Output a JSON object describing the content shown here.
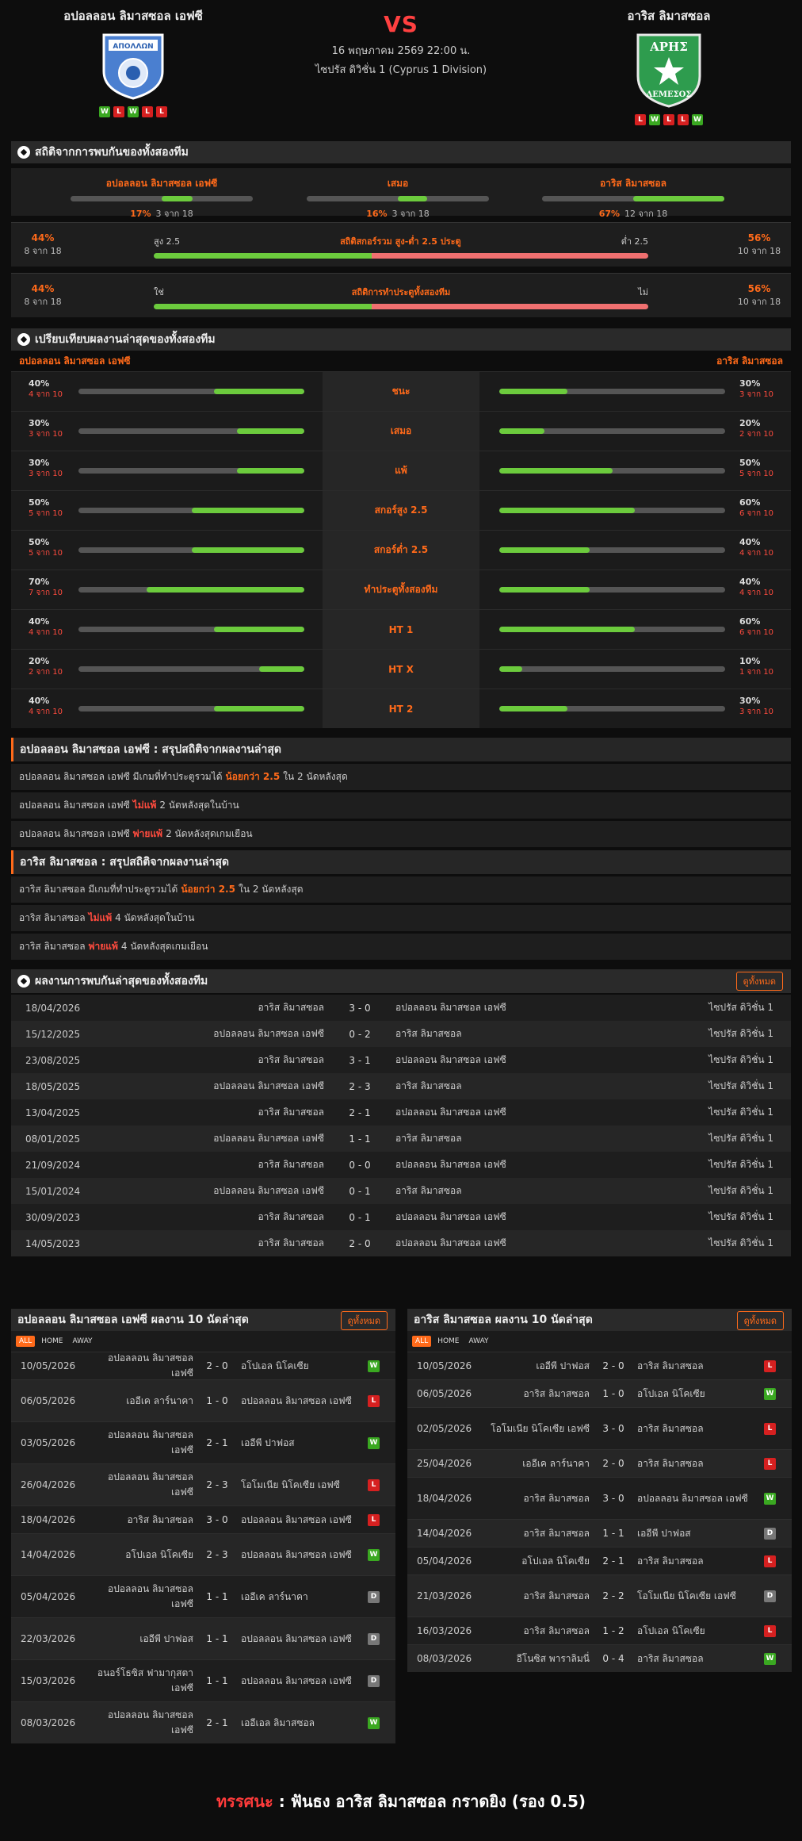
{
  "match": {
    "home": "อปอลลอน ลิมาสซอล เอฟซี",
    "away": "อาริส ลิมาสซอล",
    "vs": "VS",
    "date": "16 พฤษภาคม 2569 22:00 น.",
    "competition": "ไซปรัส ดิวิชั่น 1 (Cyprus 1 Division)",
    "home_form": [
      "W",
      "L",
      "W",
      "L",
      "L"
    ],
    "away_form": [
      "L",
      "W",
      "L",
      "L",
      "W"
    ]
  },
  "h2h": {
    "title": "สถิติจากการพบกันของทั้งสองทีม",
    "cells": [
      {
        "label": "อปอลลอน ลิมาสซอล เอฟซี",
        "pct": "17%",
        "count": "3 จาก 18",
        "fill": 0.17
      },
      {
        "label": "เสมอ",
        "pct": "16%",
        "count": "3 จาก 18",
        "fill": 0.16
      },
      {
        "label": "อาริส ลิมาสซอล",
        "pct": "67%",
        "count": "12 จาก 18",
        "fill": 0.67
      }
    ],
    "ou": {
      "l_pct": "44%",
      "l_cnt": "8 จาก 18",
      "left": "สูง 2.5",
      "mid": "สถิติสกอร์รวม สูง-ต่ำ 2.5 ประตู",
      "right": "ต่ำ 2.5",
      "r_pct": "56%",
      "r_cnt": "10 จาก 18",
      "fill": 0.44
    },
    "bt": {
      "l_pct": "44%",
      "l_cnt": "8 จาก 18",
      "left": "ใช่",
      "mid": "สถิติการทำประตูทั้งสองทีม",
      "right": "ไม่",
      "r_pct": "56%",
      "r_cnt": "10 จาก 18",
      "fill": 0.44
    }
  },
  "compare": {
    "title": "เปรียบเทียบผลงานล่าสุดของทั้งสองทีม",
    "home": "อปอลลอน ลิมาสซอล เอฟซี",
    "away": "อาริส ลิมาสซอล",
    "rows": [
      {
        "label": "ชนะ",
        "hp": "40%",
        "hc": "4 จาก 10",
        "hf": 0.4,
        "ap": "30%",
        "ac": "3 จาก 10",
        "af": 0.3
      },
      {
        "label": "เสมอ",
        "hp": "30%",
        "hc": "3 จาก 10",
        "hf": 0.3,
        "ap": "20%",
        "ac": "2 จาก 10",
        "af": 0.2
      },
      {
        "label": "แพ้",
        "hp": "30%",
        "hc": "3 จาก 10",
        "hf": 0.3,
        "ap": "50%",
        "ac": "5 จาก 10",
        "af": 0.5
      },
      {
        "label": "สกอร์สูง 2.5",
        "hp": "50%",
        "hc": "5 จาก 10",
        "hf": 0.5,
        "ap": "60%",
        "ac": "6 จาก 10",
        "af": 0.6
      },
      {
        "label": "สกอร์ต่ำ 2.5",
        "hp": "50%",
        "hc": "5 จาก 10",
        "hf": 0.5,
        "ap": "40%",
        "ac": "4 จาก 10",
        "af": 0.4
      },
      {
        "label": "ทำประตูทั้งสองทีม",
        "hp": "70%",
        "hc": "7 จาก 10",
        "hf": 0.7,
        "ap": "40%",
        "ac": "4 จาก 10",
        "af": 0.4
      },
      {
        "label": "HT 1",
        "hp": "40%",
        "hc": "4 จาก 10",
        "hf": 0.4,
        "ap": "60%",
        "ac": "6 จาก 10",
        "af": 0.6
      },
      {
        "label": "HT X",
        "hp": "20%",
        "hc": "2 จาก 10",
        "hf": 0.2,
        "ap": "10%",
        "ac": "1 จาก 10",
        "af": 0.1
      },
      {
        "label": "HT 2",
        "hp": "40%",
        "hc": "4 จาก 10",
        "hf": 0.4,
        "ap": "30%",
        "ac": "3 จาก 10",
        "af": 0.3
      }
    ]
  },
  "sum_home": {
    "title": "อปอลลอน ลิมาสซอล เอฟซี : สรุปสถิติจากผลงานล่าสุด",
    "rows": [
      {
        "a": "อปอลลอน ลิมาสซอล เอฟซี มีเกมที่ทำประตูรวมได้",
        "b": "น้อยกว่า 2.5",
        "c": "ใน 2 นัดหลังสุด",
        "color": "orange"
      },
      {
        "a": "อปอลลอน ลิมาสซอล เอฟซี",
        "b": "ไม่แพ้",
        "c": "2 นัดหลังสุดในบ้าน",
        "color": "red"
      },
      {
        "a": "อปอลลอน ลิมาสซอล เอฟซี",
        "b": "พ่ายแพ้",
        "c": "2 นัดหลังสุดเกมเยือน",
        "color": "red"
      }
    ]
  },
  "sum_away": {
    "title": "อาริส ลิมาสซอล : สรุปสถิติจากผลงานล่าสุด",
    "rows": [
      {
        "a": "อาริส ลิมาสซอล มีเกมที่ทำประตูรวมได้",
        "b": "น้อยกว่า 2.5",
        "c": "ใน 2 นัดหลังสุด",
        "color": "orange"
      },
      {
        "a": "อาริส ลิมาสซอล",
        "b": "ไม่แพ้",
        "c": "4 นัดหลังสุดในบ้าน",
        "color": "red"
      },
      {
        "a": "อาริส ลิมาสซอล",
        "b": "พ่ายแพ้",
        "c": "4 นัดหลังสุดเกมเยือน",
        "color": "red"
      }
    ]
  },
  "results": {
    "title": "ผลงานการพบกันล่าสุดของทั้งสองทีม",
    "more": "ดูทั้งหมด",
    "rows": [
      {
        "d": "18/04/2026",
        "h": "อาริส ลิมาสซอล",
        "s": "3 - 0",
        "a": "อปอลลอน ลิมาสซอล เอฟซี",
        "c": "ไซปรัส ดิวิชั่น 1"
      },
      {
        "d": "15/12/2025",
        "h": "อปอลลอน ลิมาสซอล เอฟซี",
        "s": "0 - 2",
        "a": "อาริส ลิมาสซอล",
        "c": "ไซปรัส ดิวิชั่น 1"
      },
      {
        "d": "23/08/2025",
        "h": "อาริส ลิมาสซอล",
        "s": "3 - 1",
        "a": "อปอลลอน ลิมาสซอล เอฟซี",
        "c": "ไซปรัส ดิวิชั่น 1"
      },
      {
        "d": "18/05/2025",
        "h": "อปอลลอน ลิมาสซอล เอฟซี",
        "s": "2 - 3",
        "a": "อาริส ลิมาสซอล",
        "c": "ไซปรัส ดิวิชั่น 1"
      },
      {
        "d": "13/04/2025",
        "h": "อาริส ลิมาสซอล",
        "s": "2 - 1",
        "a": "อปอลลอน ลิมาสซอล เอฟซี",
        "c": "ไซปรัส ดิวิชั่น 1"
      },
      {
        "d": "08/01/2025",
        "h": "อปอลลอน ลิมาสซอล เอฟซี",
        "s": "1 - 1",
        "a": "อาริส ลิมาสซอล",
        "c": "ไซปรัส ดิวิชั่น 1"
      },
      {
        "d": "21/09/2024",
        "h": "อาริส ลิมาสซอล",
        "s": "0 - 0",
        "a": "อปอลลอน ลิมาสซอล เอฟซี",
        "c": "ไซปรัส ดิวิชั่น 1"
      },
      {
        "d": "15/01/2024",
        "h": "อปอลลอน ลิมาสซอล เอฟซี",
        "s": "0 - 1",
        "a": "อาริส ลิมาสซอล",
        "c": "ไซปรัส ดิวิชั่น 1"
      },
      {
        "d": "30/09/2023",
        "h": "อาริส ลิมาสซอล",
        "s": "0 - 1",
        "a": "อปอลลอน ลิมาสซอล เอฟซี",
        "c": "ไซปรัส ดิวิชั่น 1"
      },
      {
        "d": "14/05/2023",
        "h": "อาริส ลิมาสซอล",
        "s": "2 - 0",
        "a": "อปอลลอน ลิมาสซอล เอฟซี",
        "c": "ไซปรัส ดิวิชั่น 1"
      }
    ]
  },
  "tabs": [
    "ALL",
    "HOME",
    "AWAY"
  ],
  "last_home": {
    "title": "อปอลลอน ลิมาสซอล เอฟซี ผลงาน 10 นัดล่าสุด",
    "more": "ดูทั้งหมด",
    "rows": [
      {
        "d": "10/05/2026",
        "h": "อปอลลอน ลิมาสซอล เอฟซี",
        "s": "2 - 0",
        "a": "อโปเอล นิโคเซีย",
        "r": "W"
      },
      {
        "d": "06/05/2026",
        "h": "เออีเค ลาร์นาคา",
        "s": "1 - 0",
        "a": "อปอลลอน ลิมาสซอล เอฟซี",
        "r": "L"
      },
      {
        "d": "03/05/2026",
        "h": "อปอลลอน ลิมาสซอล เอฟซี",
        "s": "2 - 1",
        "a": "เออีพี ปาฟอส",
        "r": "W"
      },
      {
        "d": "26/04/2026",
        "h": "อปอลลอน ลิมาสซอล เอฟซี",
        "s": "2 - 3",
        "a": "โอโมเนีย นิโคเซีย เอฟซี",
        "r": "L"
      },
      {
        "d": "18/04/2026",
        "h": "อาริส ลิมาสซอล",
        "s": "3 - 0",
        "a": "อปอลลอน ลิมาสซอล เอฟซี",
        "r": "L"
      },
      {
        "d": "14/04/2026",
        "h": "อโปเอล นิโคเซีย",
        "s": "2 - 3",
        "a": "อปอลลอน ลิมาสซอล เอฟซี",
        "r": "W"
      },
      {
        "d": "05/04/2026",
        "h": "อปอลลอน ลิมาสซอล เอฟซี",
        "s": "1 - 1",
        "a": "เออีเค ลาร์นาคา",
        "r": "D"
      },
      {
        "d": "22/03/2026",
        "h": "เออีพี ปาฟอส",
        "s": "1 - 1",
        "a": "อปอลลอน ลิมาสซอล เอฟซี",
        "r": "D"
      },
      {
        "d": "15/03/2026",
        "h": "อนอร์โธซิส ฟามากุสตา เอฟซี",
        "s": "1 - 1",
        "a": "อปอลลอน ลิมาสซอล เอฟซี",
        "r": "D"
      },
      {
        "d": "08/03/2026",
        "h": "อปอลลอน ลิมาสซอล เอฟซี",
        "s": "2 - 1",
        "a": "เออีเอล ลิมาสซอล",
        "r": "W"
      }
    ]
  },
  "last_away": {
    "title": "อาริส ลิมาสซอล ผลงาน 10 นัดล่าสุด",
    "more": "ดูทั้งหมด",
    "rows": [
      {
        "d": "10/05/2026",
        "h": "เออีพี ปาฟอส",
        "s": "2 - 0",
        "a": "อาริส ลิมาสซอล",
        "r": "L"
      },
      {
        "d": "06/05/2026",
        "h": "อาริส ลิมาสซอล",
        "s": "1 - 0",
        "a": "อโปเอล นิโคเซีย",
        "r": "W"
      },
      {
        "d": "02/05/2026",
        "h": "โอโมเนีย นิโคเซีย เอฟซี",
        "s": "3 - 0",
        "a": "อาริส ลิมาสซอล",
        "r": "L"
      },
      {
        "d": "25/04/2026",
        "h": "เออีเค ลาร์นาคา",
        "s": "2 - 0",
        "a": "อาริส ลิมาสซอล",
        "r": "L"
      },
      {
        "d": "18/04/2026",
        "h": "อาริส ลิมาสซอล",
        "s": "3 - 0",
        "a": "อปอลลอน ลิมาสซอล เอฟซี",
        "r": "W"
      },
      {
        "d": "14/04/2026",
        "h": "อาริส ลิมาสซอล",
        "s": "1 - 1",
        "a": "เออีพี ปาฟอส",
        "r": "D"
      },
      {
        "d": "05/04/2026",
        "h": "อโปเอล นิโคเซีย",
        "s": "2 - 1",
        "a": "อาริส ลิมาสซอล",
        "r": "L"
      },
      {
        "d": "21/03/2026",
        "h": "อาริส ลิมาสซอล",
        "s": "2 - 2",
        "a": "โอโมเนีย นิโคเซีย เอฟซี",
        "r": "D"
      },
      {
        "d": "16/03/2026",
        "h": "อาริส ลิมาสซอล",
        "s": "1 - 2",
        "a": "อโปเอล นิโคเซีย",
        "r": "L"
      },
      {
        "d": "08/03/2026",
        "h": "อีโนซิส พาราลิมนี่",
        "s": "0 - 4",
        "a": "อาริส ลิมาสซอล",
        "r": "W"
      }
    ]
  },
  "tip": {
    "label": "ทรรศนะ",
    "sep": ":",
    "text": "ฟันธง อาริส ลิมาสซอล กราดยิง (รอง 0.5)"
  },
  "logos": {
    "home_text": "ΑΠΟΛΛΩΝ",
    "away_text1": "ΑΡΗΣ",
    "away_text2": "ΛΕΜΕΣΟΣ"
  },
  "colors": {
    "accent": "#ff6a1a",
    "green": "#6ccb3d",
    "red_bar": "#f07070",
    "win": "#3aa821",
    "loss": "#d62020",
    "draw": "#777777"
  }
}
